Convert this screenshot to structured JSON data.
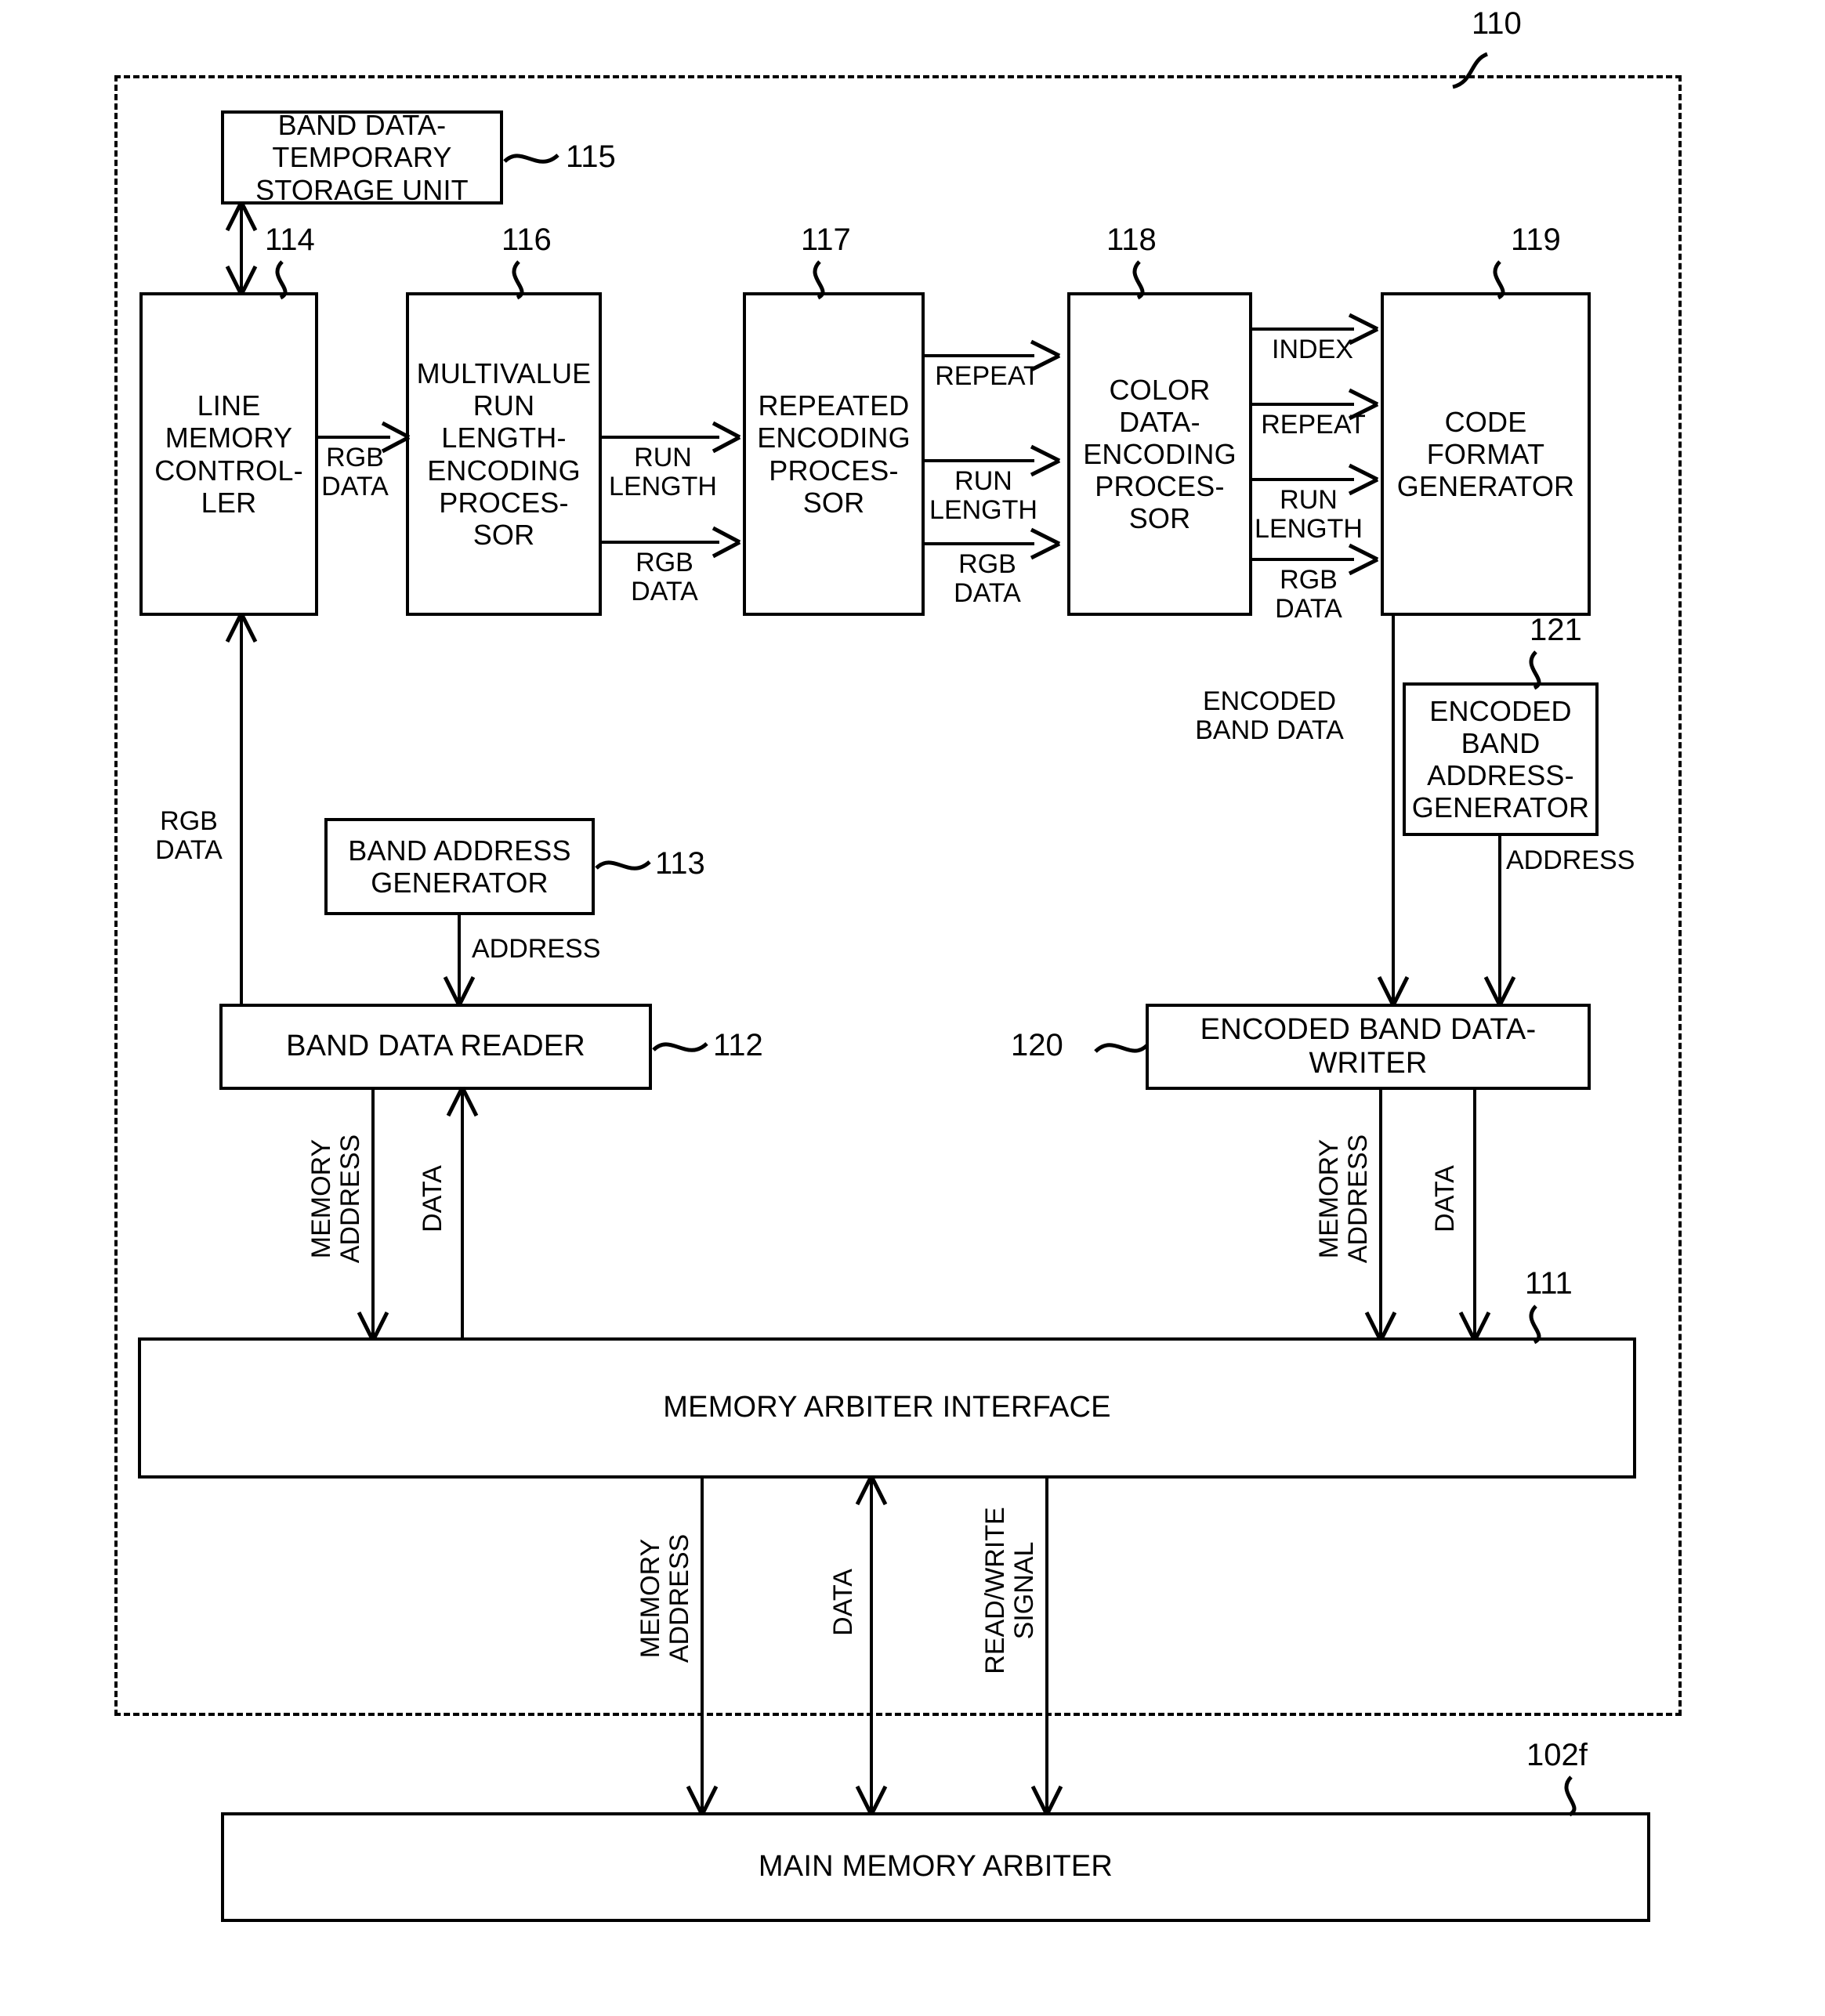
{
  "figure": {
    "outer_ref": "110",
    "bottom_ref": "102f"
  },
  "blocks": {
    "band_temp_storage": {
      "label": "BAND DATA-\nTEMPORARY\nSTORAGE UNIT",
      "ref": "115"
    },
    "line_memory_controller": {
      "label": "LINE\nMEMORY\nCONTROL-\nLER",
      "ref": "114"
    },
    "multivalue_rle": {
      "label": "MULTIVALUE\nRUN\nLENGTH-\nENCODING\nPROCES-\nSOR",
      "ref": "116"
    },
    "repeated_encoding": {
      "label": "REPEATED\nENCODING\nPROCES-\nSOR",
      "ref": "117"
    },
    "color_data_encoding": {
      "label": "COLOR\nDATA-\nENCODING\nPROCES-\nSOR",
      "ref": "118"
    },
    "code_format_generator": {
      "label": "CODE\nFORMAT\nGENERATOR",
      "ref": "119"
    },
    "encoded_band_addr_gen": {
      "label": "ENCODED\nBAND\nADDRESS-\nGENERATOR",
      "ref": "121"
    },
    "band_address_generator": {
      "label": "BAND ADDRESS\nGENERATOR",
      "ref": "113"
    },
    "band_data_reader": {
      "label": "BAND DATA READER",
      "ref": "112"
    },
    "encoded_band_data_writer": {
      "label": "ENCODED BAND DATA-\nWRITER",
      "ref": "120"
    },
    "memory_arbiter_interface": {
      "label": "MEMORY ARBITER INTERFACE",
      "ref": "111"
    },
    "main_memory_arbiter": {
      "label": "MAIN MEMORY ARBITER",
      "ref": "102f"
    }
  },
  "signals": {
    "rgb_data_1": "RGB\nDATA",
    "run_length_1": "RUN\nLENGTH",
    "rgb_data_2": "RGB\nDATA",
    "repeat_1": "REPEAT",
    "run_length_2": "RUN\nLENGTH",
    "rgb_data_3": "RGB\nDATA",
    "index": "INDEX",
    "repeat_2": "REPEAT",
    "run_length_3": "RUN\nLENGTH",
    "rgb_data_4": "RGB\nDATA",
    "encoded_band_data": "ENCODED\nBAND DATA",
    "address_right": "ADDRESS",
    "rgb_data_feedback": "RGB\nDATA",
    "address_left": "ADDRESS",
    "mem_addr_left": "MEMORY\nADDRESS",
    "data_left": "DATA",
    "mem_addr_right": "MEMORY\nADDRESS",
    "data_right": "DATA",
    "mem_addr_bottom": "MEMORY\nADDRESS",
    "data_bottom": "DATA",
    "read_write_signal": "READ/WRITE\nSIGNAL"
  }
}
